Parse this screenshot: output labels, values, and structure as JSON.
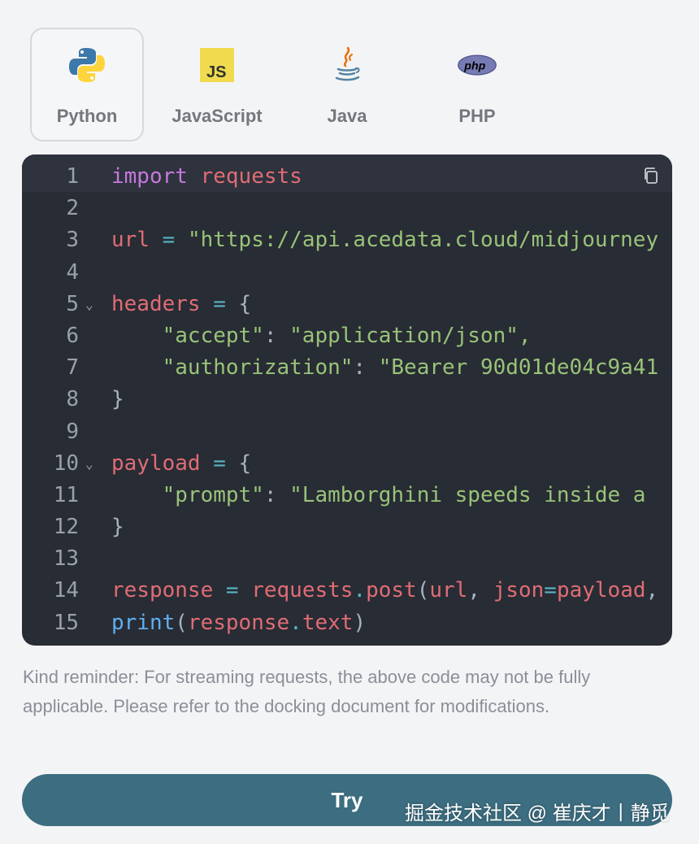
{
  "tabs": [
    {
      "label": "Python",
      "icon": "python-icon",
      "active": true
    },
    {
      "label": "JavaScript",
      "icon": "javascript-icon",
      "active": false
    },
    {
      "label": "Java",
      "icon": "java-icon",
      "active": false
    },
    {
      "label": "PHP",
      "icon": "php-icon",
      "active": false
    }
  ],
  "code": {
    "copy_icon": "copy-icon",
    "line_numbers": [
      "1",
      "2",
      "3",
      "4",
      "5",
      "6",
      "7",
      "8",
      "9",
      "10",
      "11",
      "12",
      "13",
      "14",
      "15"
    ],
    "lines": [
      {
        "t1": "import",
        "t2": " ",
        "t3": "requests"
      },
      {},
      {
        "t1": "url",
        "t2": " = ",
        "t3": "\"https://api.acedata.cloud/midjourney"
      },
      {},
      {
        "t1": "headers",
        "t2": " = ",
        "t3": "{"
      },
      {
        "t1": "    \"accept\"",
        "t2": ": ",
        "t3": "\"application/json\","
      },
      {
        "t1": "    \"authorization\"",
        "t2": ": ",
        "t3": "\"Bearer 90d01de04c9a41"
      },
      {
        "t1": "}"
      },
      {},
      {
        "t1": "payload",
        "t2": " = ",
        "t3": "{"
      },
      {
        "t1": "    \"prompt\"",
        "t2": ": ",
        "t3": "\"Lamborghini speeds inside a"
      },
      {
        "t1": "}"
      },
      {},
      {
        "t1": "response",
        "t2": " = ",
        "t3": "requests",
        "t4": ".",
        "t5": "post",
        "t6": "(",
        "t7": "url",
        "t8": ", ",
        "t9": "json",
        "t10": "=",
        "t11": "payload",
        "t12": ","
      },
      {
        "t1": "print",
        "t2": "(",
        "t3": "response",
        "t4": ".",
        "t5": "text",
        "t6": ")"
      }
    ]
  },
  "reminder": "Kind reminder: For streaming requests, the above code may not be fully applicable. Please refer to the docking document for modifications.",
  "try_label": "Try",
  "watermark": "掘金技术社区 @ 崔庆才丨静觅",
  "colors": {
    "accent": "#3c6d80",
    "code_bg": "#282c34"
  }
}
